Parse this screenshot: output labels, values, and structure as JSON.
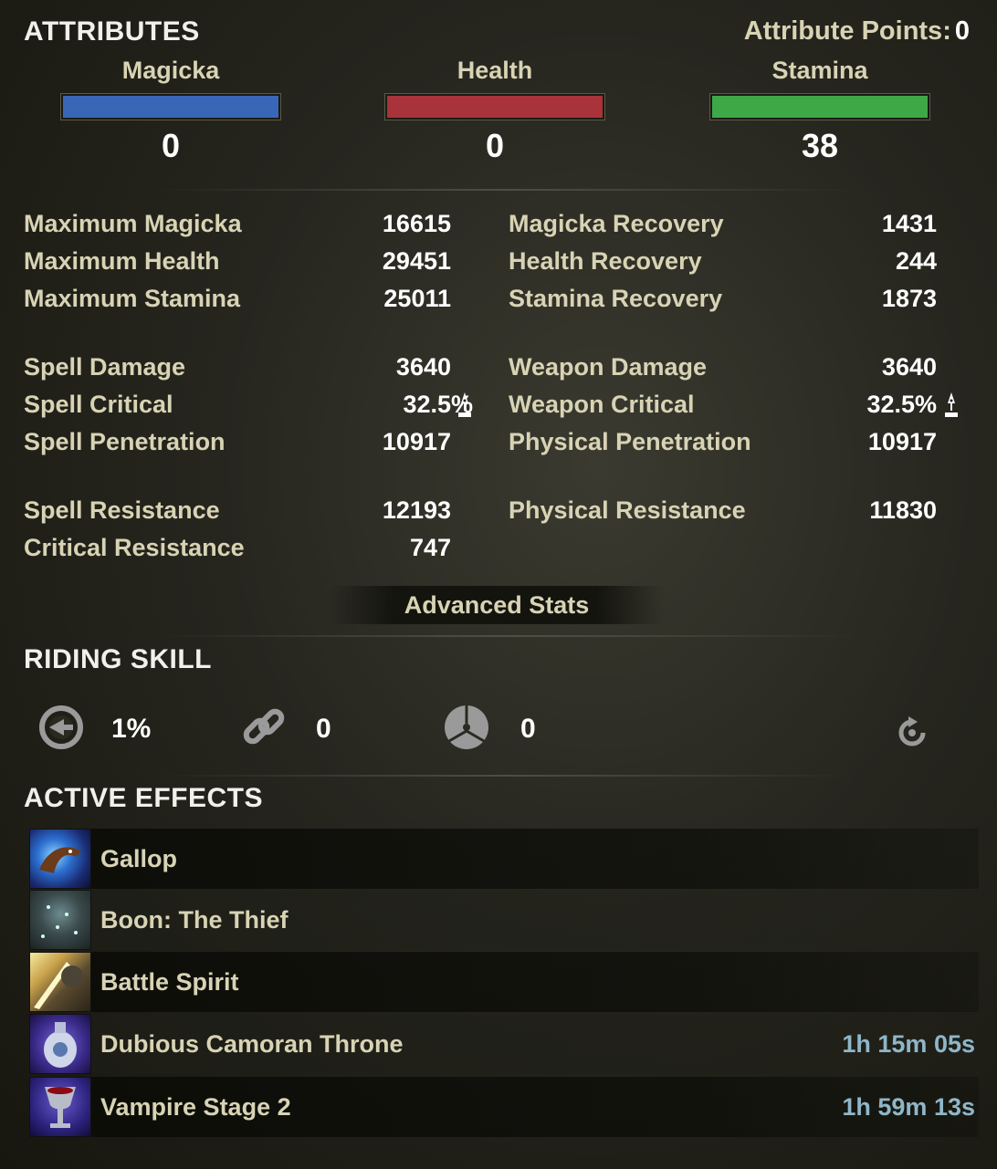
{
  "attributes": {
    "title": "ATTRIBUTES",
    "points_label": "Attribute Points:",
    "points_value": "0",
    "magicka": {
      "name": "Magicka",
      "value": "0",
      "color": "#3a66b8"
    },
    "health": {
      "name": "Health",
      "value": "0",
      "color": "#a8333a"
    },
    "stamina": {
      "name": "Stamina",
      "value": "38",
      "color": "#3ea848"
    }
  },
  "stats": {
    "max_magicka": {
      "label": "Maximum Magicka",
      "value": "16615"
    },
    "max_health": {
      "label": "Maximum Health",
      "value": "29451"
    },
    "max_stamina": {
      "label": "Maximum Stamina",
      "value": "25011"
    },
    "magicka_recovery": {
      "label": "Magicka Recovery",
      "value": "1431"
    },
    "health_recovery": {
      "label": "Health Recovery",
      "value": "244"
    },
    "stamina_recovery": {
      "label": "Stamina Recovery",
      "value": "1873"
    },
    "spell_damage": {
      "label": "Spell Damage",
      "value": "3640"
    },
    "spell_critical": {
      "label": "Spell Critical",
      "value": "32.5%"
    },
    "spell_penetration": {
      "label": "Spell Penetration",
      "value": "10917"
    },
    "weapon_damage": {
      "label": "Weapon Damage",
      "value": "3640"
    },
    "weapon_critical": {
      "label": "Weapon Critical",
      "value": "32.5%"
    },
    "physical_penetration": {
      "label": "Physical Penetration",
      "value": "10917"
    },
    "spell_resistance": {
      "label": "Spell Resistance",
      "value": "12193"
    },
    "critical_resistance": {
      "label": "Critical Resistance",
      "value": "747"
    },
    "physical_resistance": {
      "label": "Physical Resistance",
      "value": "11830"
    }
  },
  "advanced_stats_label": "Advanced Stats",
  "riding": {
    "title": "RIDING SKILL",
    "speed": {
      "icon": "speed-icon",
      "value": "1%"
    },
    "stamina": {
      "icon": "chain-link-icon",
      "value": "0"
    },
    "capacity": {
      "icon": "capacity-icon",
      "value": "0"
    },
    "refresh_icon": "refresh-icon"
  },
  "effects": {
    "title": "ACTIVE EFFECTS",
    "items": [
      {
        "name": "Gallop",
        "time": ""
      },
      {
        "name": "Boon: The Thief",
        "time": ""
      },
      {
        "name": "Battle Spirit",
        "time": ""
      },
      {
        "name": "Dubious Camoran Throne",
        "time": "1h 15m 05s"
      },
      {
        "name": "Vampire Stage 2",
        "time": "1h 59m 13s"
      }
    ]
  }
}
